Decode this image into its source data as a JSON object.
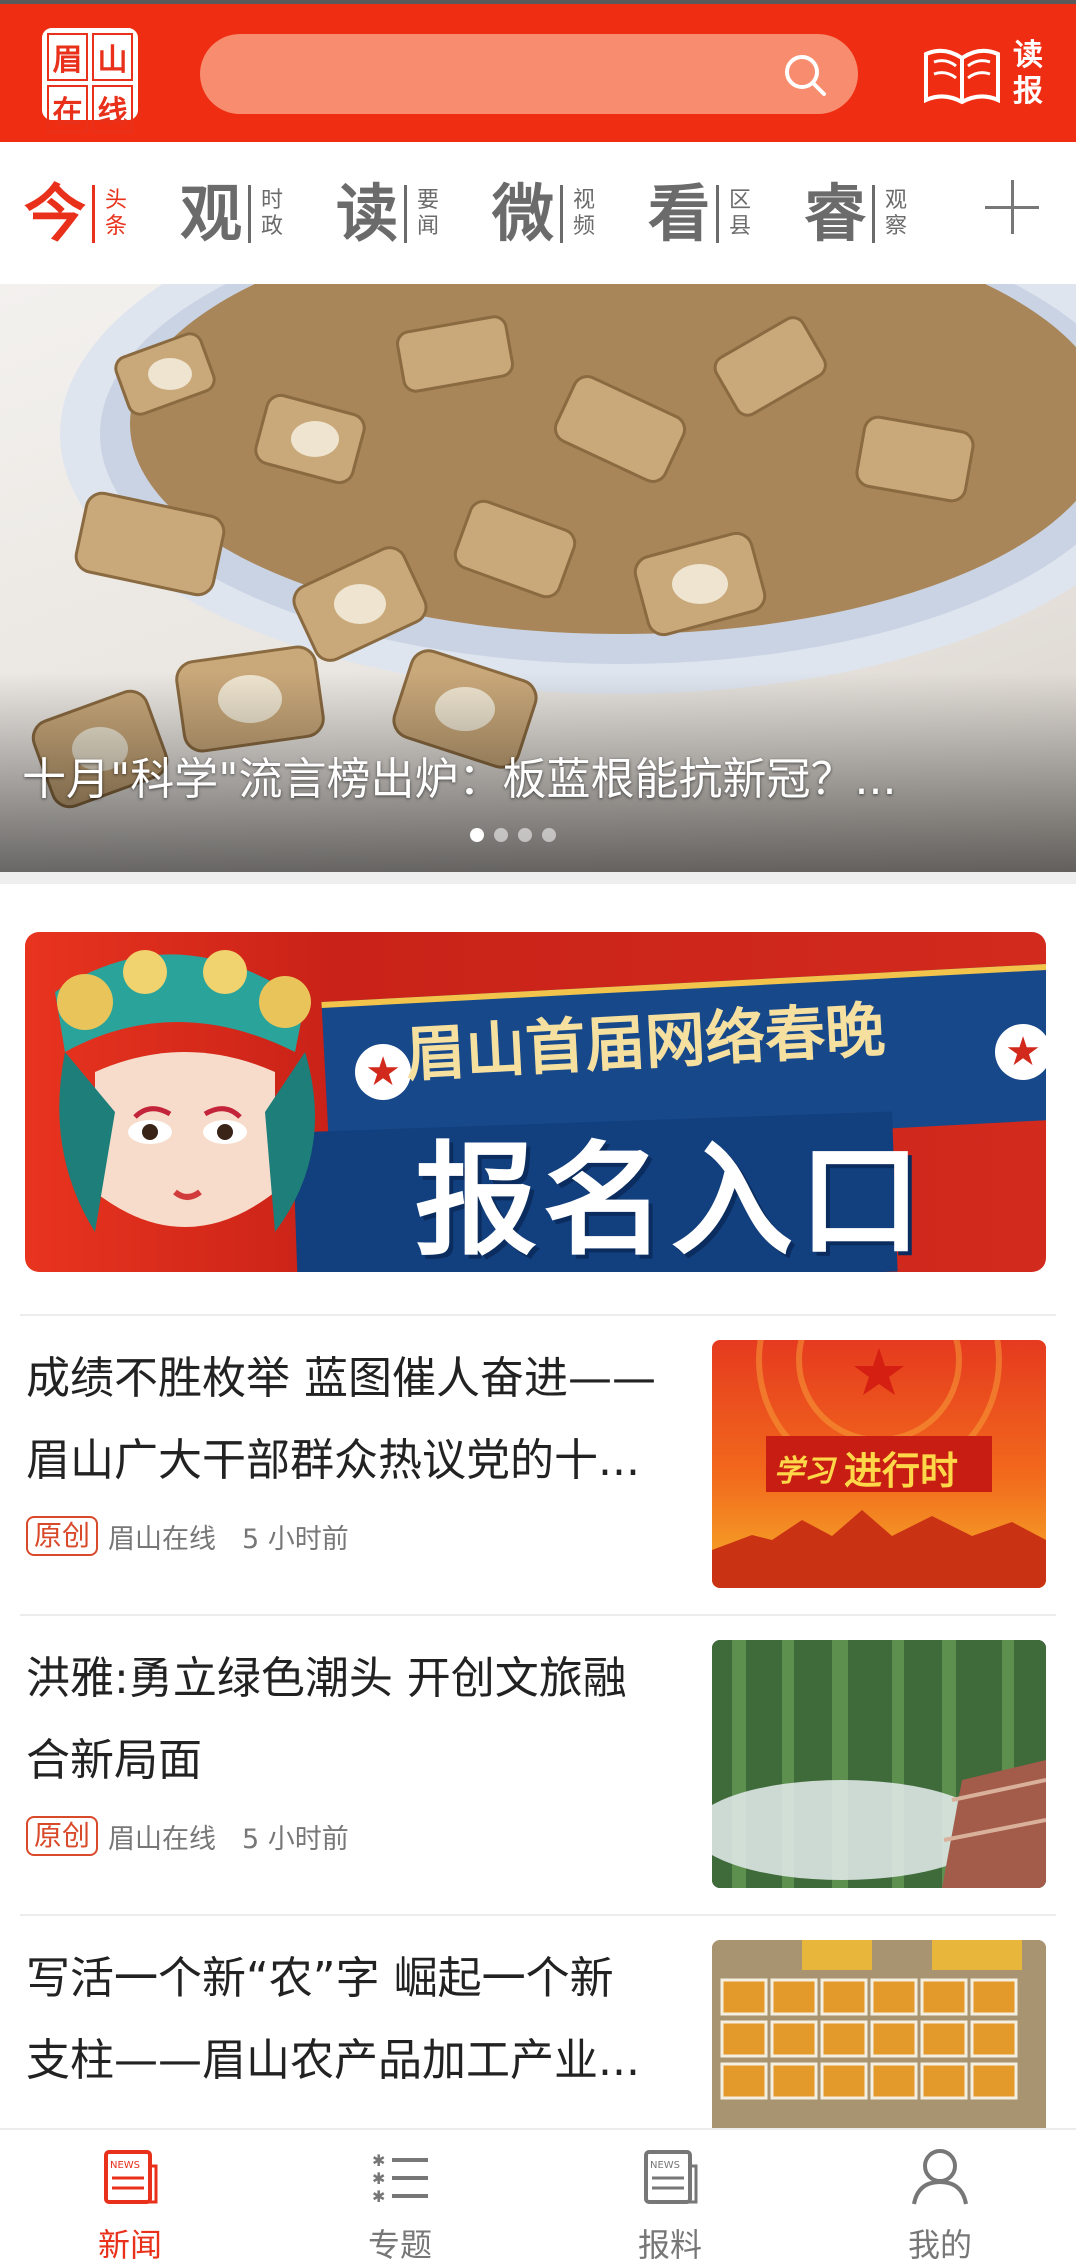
{
  "header": {
    "logo_chars": [
      "眉",
      "山",
      "在",
      "线"
    ],
    "search_placeholder": "",
    "read_label_1": "读",
    "read_label_2": "报"
  },
  "channels": [
    {
      "big": "今",
      "sub1": "头",
      "sub2": "条",
      "active": true
    },
    {
      "big": "观",
      "sub1": "时",
      "sub2": "政",
      "active": false
    },
    {
      "big": "读",
      "sub1": "要",
      "sub2": "闻",
      "active": false
    },
    {
      "big": "微",
      "sub1": "视",
      "sub2": "频",
      "active": false
    },
    {
      "big": "看",
      "sub1": "区",
      "sub2": "县",
      "active": false
    },
    {
      "big": "睿",
      "sub1": "观",
      "sub2": "察",
      "active": false
    }
  ],
  "hero": {
    "title": "十月\"科学\"流言榜出炉：板蓝根能抗新冠？...",
    "slide_count": 4,
    "active_slide": 1
  },
  "banner": {
    "line1": "眉山首届网络春晚",
    "line2": "报名入口"
  },
  "news": [
    {
      "title_line1": "成绩不胜枚举 蓝图催人奋进——",
      "title_line2": "眉山广大干部群众热议党的十...",
      "tag": "原创",
      "source": "眉山在线",
      "time": "5 小时前",
      "thumb_text_1": "学习",
      "thumb_text_2": "进行时"
    },
    {
      "title_line1": "洪雅:勇立绿色潮头 开创文旅融",
      "title_line2": "合新局面",
      "tag": "原创",
      "source": "眉山在线",
      "time": "5 小时前"
    },
    {
      "title_line1": "写活一个新“农”字 崛起一个新",
      "title_line2": "支柱——眉山农产品加工产业..."
    }
  ],
  "tabbar": [
    {
      "label": "新闻",
      "icon": "news-icon",
      "active": true
    },
    {
      "label": "专题",
      "icon": "list-icon",
      "active": false
    },
    {
      "label": "报料",
      "icon": "report-icon",
      "active": false
    },
    {
      "label": "我的",
      "icon": "user-icon",
      "active": false
    }
  ],
  "colors": {
    "brand_red": "#ef2d12",
    "accent_red": "#e8301a",
    "search_bg": "#f78c6f",
    "inactive": "#6b6b6b"
  }
}
